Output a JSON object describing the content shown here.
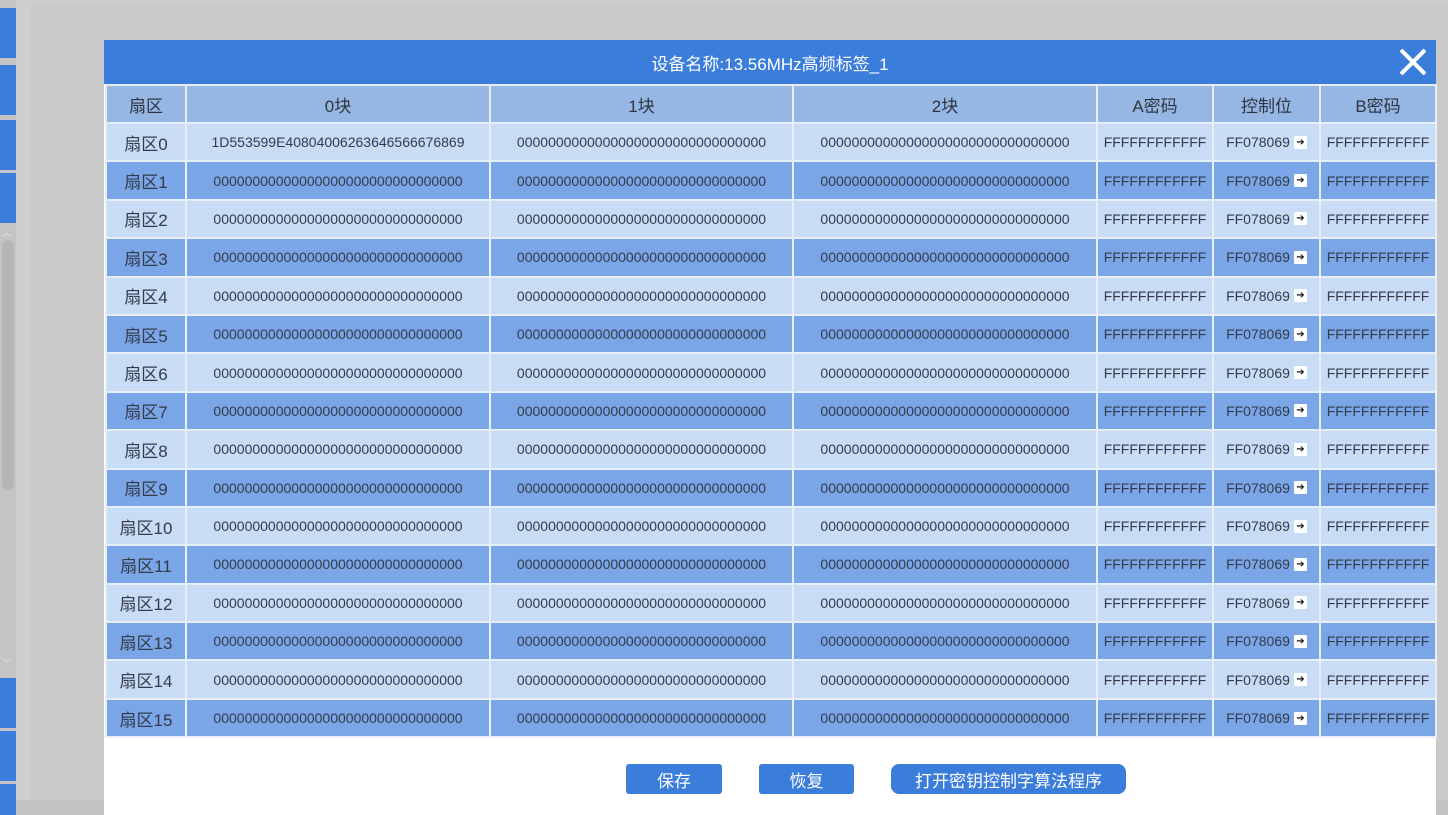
{
  "dialog": {
    "title": "设备名称:13.56MHz高频标签_1"
  },
  "table": {
    "headers": [
      "扇区",
      "0块",
      "1块",
      "2块",
      "A密码",
      "控制位",
      "B密码"
    ],
    "rows": [
      {
        "sector": "扇区0",
        "b0": "1D553599E40804006263646566676869",
        "b1": "00000000000000000000000000000000",
        "b2": "00000000000000000000000000000000",
        "keyA": "FFFFFFFFFFFF",
        "ctrl": "FF078069",
        "keyB": "FFFFFFFFFFFF"
      },
      {
        "sector": "扇区1",
        "b0": "00000000000000000000000000000000",
        "b1": "00000000000000000000000000000000",
        "b2": "00000000000000000000000000000000",
        "keyA": "FFFFFFFFFFFF",
        "ctrl": "FF078069",
        "keyB": "FFFFFFFFFFFF"
      },
      {
        "sector": "扇区2",
        "b0": "00000000000000000000000000000000",
        "b1": "00000000000000000000000000000000",
        "b2": "00000000000000000000000000000000",
        "keyA": "FFFFFFFFFFFF",
        "ctrl": "FF078069",
        "keyB": "FFFFFFFFFFFF"
      },
      {
        "sector": "扇区3",
        "b0": "00000000000000000000000000000000",
        "b1": "00000000000000000000000000000000",
        "b2": "00000000000000000000000000000000",
        "keyA": "FFFFFFFFFFFF",
        "ctrl": "FF078069",
        "keyB": "FFFFFFFFFFFF"
      },
      {
        "sector": "扇区4",
        "b0": "00000000000000000000000000000000",
        "b1": "00000000000000000000000000000000",
        "b2": "00000000000000000000000000000000",
        "keyA": "FFFFFFFFFFFF",
        "ctrl": "FF078069",
        "keyB": "FFFFFFFFFFFF"
      },
      {
        "sector": "扇区5",
        "b0": "00000000000000000000000000000000",
        "b1": "00000000000000000000000000000000",
        "b2": "00000000000000000000000000000000",
        "keyA": "FFFFFFFFFFFF",
        "ctrl": "FF078069",
        "keyB": "FFFFFFFFFFFF"
      },
      {
        "sector": "扇区6",
        "b0": "00000000000000000000000000000000",
        "b1": "00000000000000000000000000000000",
        "b2": "00000000000000000000000000000000",
        "keyA": "FFFFFFFFFFFF",
        "ctrl": "FF078069",
        "keyB": "FFFFFFFFFFFF"
      },
      {
        "sector": "扇区7",
        "b0": "00000000000000000000000000000000",
        "b1": "00000000000000000000000000000000",
        "b2": "00000000000000000000000000000000",
        "keyA": "FFFFFFFFFFFF",
        "ctrl": "FF078069",
        "keyB": "FFFFFFFFFFFF"
      },
      {
        "sector": "扇区8",
        "b0": "00000000000000000000000000000000",
        "b1": "00000000000000000000000000000000",
        "b2": "00000000000000000000000000000000",
        "keyA": "FFFFFFFFFFFF",
        "ctrl": "FF078069",
        "keyB": "FFFFFFFFFFFF"
      },
      {
        "sector": "扇区9",
        "b0": "00000000000000000000000000000000",
        "b1": "00000000000000000000000000000000",
        "b2": "00000000000000000000000000000000",
        "keyA": "FFFFFFFFFFFF",
        "ctrl": "FF078069",
        "keyB": "FFFFFFFFFFFF"
      },
      {
        "sector": "扇区10",
        "b0": "00000000000000000000000000000000",
        "b1": "00000000000000000000000000000000",
        "b2": "00000000000000000000000000000000",
        "keyA": "FFFFFFFFFFFF",
        "ctrl": "FF078069",
        "keyB": "FFFFFFFFFFFF"
      },
      {
        "sector": "扇区11",
        "b0": "00000000000000000000000000000000",
        "b1": "00000000000000000000000000000000",
        "b2": "00000000000000000000000000000000",
        "keyA": "FFFFFFFFFFFF",
        "ctrl": "FF078069",
        "keyB": "FFFFFFFFFFFF"
      },
      {
        "sector": "扇区12",
        "b0": "00000000000000000000000000000000",
        "b1": "00000000000000000000000000000000",
        "b2": "00000000000000000000000000000000",
        "keyA": "FFFFFFFFFFFF",
        "ctrl": "FF078069",
        "keyB": "FFFFFFFFFFFF"
      },
      {
        "sector": "扇区13",
        "b0": "00000000000000000000000000000000",
        "b1": "00000000000000000000000000000000",
        "b2": "00000000000000000000000000000000",
        "keyA": "FFFFFFFFFFFF",
        "ctrl": "FF078069",
        "keyB": "FFFFFFFFFFFF"
      },
      {
        "sector": "扇区14",
        "b0": "00000000000000000000000000000000",
        "b1": "00000000000000000000000000000000",
        "b2": "00000000000000000000000000000000",
        "keyA": "FFFFFFFFFFFF",
        "ctrl": "FF078069",
        "keyB": "FFFFFFFFFFFF"
      },
      {
        "sector": "扇区15",
        "b0": "00000000000000000000000000000000",
        "b1": "00000000000000000000000000000000",
        "b2": "00000000000000000000000000000000",
        "keyA": "FFFFFFFFFFFF",
        "ctrl": "FF078069",
        "keyB": "FFFFFFFFFFFF"
      }
    ]
  },
  "buttons": {
    "save": "保存",
    "restore": "恢复",
    "open_program": "打开密钥控制字算法程序"
  },
  "icons": {
    "close": "close-icon",
    "ctrl_arrow": "arrow-right-icon"
  },
  "colors": {
    "accent": "#3b7ddb",
    "row_light": "#c9dcf6",
    "row_dark": "#7aa5e6",
    "header": "#96b6e4"
  }
}
